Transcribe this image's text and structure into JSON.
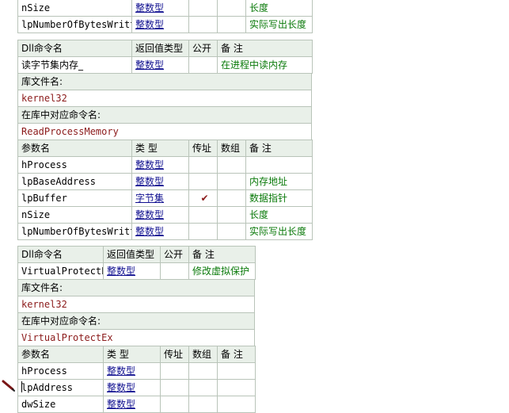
{
  "header": {
    "col_name": "Dll命令名",
    "col_return": "返回值类型",
    "col_public": "公开",
    "col_note": "备 注",
    "lib_label": "库文件名:",
    "cmd_label": "在库中对应命令名:",
    "p_name": "参数名",
    "p_type": "类 型",
    "p_byref": "传址",
    "p_array": "数组",
    "p_note": "备 注"
  },
  "block0_rows": [
    {
      "name": "nSize",
      "type": "整数型",
      "byref": "",
      "array": "",
      "note": "长度"
    },
    {
      "name": "lpNumberOfBytesWritten",
      "type": "整数型",
      "byref": "",
      "array": "",
      "note": "实际写出长度"
    }
  ],
  "dll1": {
    "name": "读字节集内存_",
    "return_type": "整数型",
    "public": "",
    "note": "在进程中读内存",
    "lib": "kernel32",
    "cmd": "ReadProcessMemory",
    "params": [
      {
        "name": "hProcess",
        "type": "整数型",
        "byref": "",
        "array": "",
        "note": ""
      },
      {
        "name": "lpBaseAddress",
        "type": "整数型",
        "byref": "",
        "array": "",
        "note": "内存地址"
      },
      {
        "name": "lpBuffer",
        "type": "字节集",
        "byref": "✔",
        "array": "",
        "note": "数据指针"
      },
      {
        "name": "nSize",
        "type": "整数型",
        "byref": "",
        "array": "",
        "note": "长度"
      },
      {
        "name": "lpNumberOfBytesWritten",
        "type": "整数型",
        "byref": "",
        "array": "",
        "note": "实际写出长度"
      }
    ]
  },
  "dll2": {
    "name": "VirtualProtectEx",
    "return_type": "整数型",
    "public": "",
    "note": "修改虚拟保护",
    "lib": "kernel32",
    "cmd": "VirtualProtectEx",
    "params": [
      {
        "name": "hProcess",
        "type": "整数型",
        "byref": "",
        "array": "",
        "note": ""
      },
      {
        "name": "lpAddress",
        "type": "整数型",
        "byref": "",
        "array": "",
        "note": ""
      },
      {
        "name": "dwSize",
        "type": "整数型",
        "byref": "",
        "array": "",
        "note": ""
      }
    ]
  },
  "colors": {
    "header_bg": "#e9f0e9",
    "border": "#b9c4b9",
    "note": "#0a7a0a",
    "type": "#101090",
    "lib": "#8b1a1a"
  },
  "icons": {
    "cursor": "pencil-icon",
    "check": "check-icon"
  }
}
